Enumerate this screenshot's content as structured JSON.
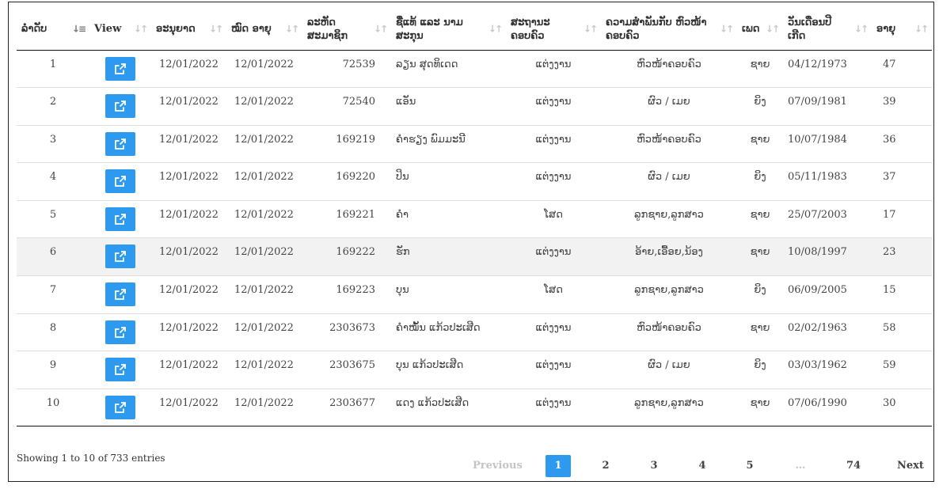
{
  "columns": [
    {
      "label": "ລຳດັບ",
      "sort": "asc"
    },
    {
      "label": "View",
      "sort": "none"
    },
    {
      "label": "ອະນຸຍາດ",
      "sort": "none"
    },
    {
      "label": "ໝົດ ອາຍຸ",
      "sort": "none"
    },
    {
      "label": "ລະຫັດ ສະມາຊິກ",
      "sort": "none"
    },
    {
      "label": "ຊື່ແທ້ ແລະ ນາມ ສະກຸນ",
      "sort": "none"
    },
    {
      "label": "ສະຖານະ ຄອບຄົວ",
      "sort": "none"
    },
    {
      "label": "ຄວາມສຳພັນກັບ ຫົວໜ້າຄອບຄົວ",
      "sort": "none"
    },
    {
      "label": "ເພດ",
      "sort": "none"
    },
    {
      "label": "ວັນເດືອນປີ ເກີດ",
      "sort": "none"
    },
    {
      "label": "ອາຍຸ",
      "sort": "none"
    }
  ],
  "rows": [
    {
      "no": "1",
      "issued": "12/01/2022",
      "expiry": "12/01/2022",
      "member_id": "72539",
      "name": "ລຽນ ສຸດທິເດດ",
      "status": "ແຕ່ງງານ",
      "relation": "ຫົວໜ້າຄອບຄົວ",
      "gender": "ຊາຍ",
      "dob": "04/12/1973",
      "age": "47"
    },
    {
      "no": "2",
      "issued": "12/01/2022",
      "expiry": "12/01/2022",
      "member_id": "72540",
      "name": "ແອັນ",
      "status": "ແຕ່ງງານ",
      "relation": "ຜົວ / ເມຍ",
      "gender": "ຍິງ",
      "dob": "07/09/1981",
      "age": "39"
    },
    {
      "no": "3",
      "issued": "12/01/2022",
      "expiry": "12/01/2022",
      "member_id": "169219",
      "name": "ຄຳຮຽງ ພົມມະນີ",
      "status": "ແຕ່ງງານ",
      "relation": "ຫົວໜ້າຄອບຄົວ",
      "gender": "ຊາຍ",
      "dob": "10/07/1984",
      "age": "36"
    },
    {
      "no": "4",
      "issued": "12/01/2022",
      "expiry": "12/01/2022",
      "member_id": "169220",
      "name": "ປິນ",
      "status": "ແຕ່ງງານ",
      "relation": "ຜົວ / ເມຍ",
      "gender": "ຍິງ",
      "dob": "05/11/1983",
      "age": "37"
    },
    {
      "no": "5",
      "issued": "12/01/2022",
      "expiry": "12/01/2022",
      "member_id": "169221",
      "name": "ຄຳ",
      "status": "ໂສດ",
      "relation": "ລູກຊາຍ,ລູກສາວ",
      "gender": "ຊາຍ",
      "dob": "25/07/2003",
      "age": "17"
    },
    {
      "no": "6",
      "issued": "12/01/2022",
      "expiry": "12/01/2022",
      "member_id": "169222",
      "name": "ຮັກ",
      "status": "ແຕ່ງງານ",
      "relation": "ອ້າຍ,ເອື້ອຍ,ນ້ອງ",
      "gender": "ຊາຍ",
      "dob": "10/08/1997",
      "age": "23"
    },
    {
      "no": "7",
      "issued": "12/01/2022",
      "expiry": "12/01/2022",
      "member_id": "169223",
      "name": "ບຸນ",
      "status": "ໂສດ",
      "relation": "ລູກຊາຍ,ລູກສາວ",
      "gender": "ຍິງ",
      "dob": "06/09/2005",
      "age": "15"
    },
    {
      "no": "8",
      "issued": "12/01/2022",
      "expiry": "12/01/2022",
      "member_id": "2303673",
      "name": "ຄຳໝັ້ນ ແກ້ວປະເສີດ",
      "status": "ແຕ່ງງານ",
      "relation": "ຫົວໜ້າຄອບຄົວ",
      "gender": "ຊາຍ",
      "dob": "02/02/1963",
      "age": "58"
    },
    {
      "no": "9",
      "issued": "12/01/2022",
      "expiry": "12/01/2022",
      "member_id": "2303675",
      "name": "ບຸນ ແກ້ວປະເສີດ",
      "status": "ແຕ່ງງານ",
      "relation": "ຜົວ / ເມຍ",
      "gender": "ຍິງ",
      "dob": "03/03/1962",
      "age": "59"
    },
    {
      "no": "10",
      "issued": "12/01/2022",
      "expiry": "12/01/2022",
      "member_id": "2303677",
      "name": "ແດງ ແກ້ວປະເສີດ",
      "status": "ແຕ່ງງານ",
      "relation": "ລູກຊາຍ,ລູກສາວ",
      "gender": "ຊາຍ",
      "dob": "07/06/1990",
      "age": "30"
    }
  ],
  "highlighted_row": 6,
  "info": "Showing 1 to 10 of 733 entries",
  "pagination": {
    "previous": "Previous",
    "pages": [
      "1",
      "2",
      "3",
      "4",
      "5"
    ],
    "ellipsis": "…",
    "last": "74",
    "next": "Next",
    "current": "1"
  },
  "colors": {
    "accent": "#2d9af0",
    "row_highlight": "#f2f2f2"
  }
}
